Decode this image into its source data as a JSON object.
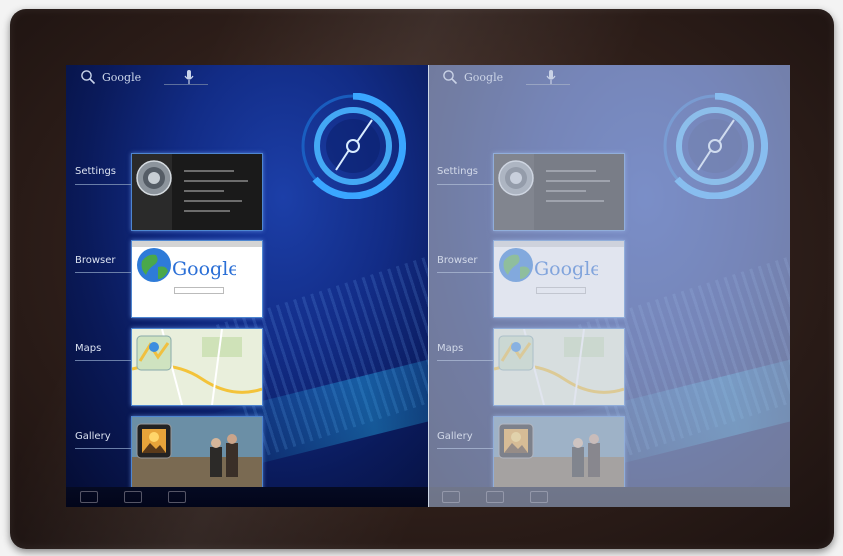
{
  "search": {
    "label": "Google"
  },
  "recent_apps": [
    {
      "label": "Settings"
    },
    {
      "label": "Browser"
    },
    {
      "label": "Maps"
    },
    {
      "label": "Gallery"
    }
  ],
  "browser_thumbnail": {
    "logo_text": "Google"
  },
  "icons": [
    "search-icon",
    "microphone-icon",
    "clock-widget",
    "settings-app-icon",
    "browser-globe-icon",
    "maps-app-icon",
    "gallery-app-icon",
    "back-icon",
    "home-icon",
    "recent-apps-icon"
  ],
  "colors": {
    "bezel": "#2f1f1a",
    "screen": "#122c86",
    "accent": "#4e86d0",
    "clock": "#3aa6ff"
  }
}
